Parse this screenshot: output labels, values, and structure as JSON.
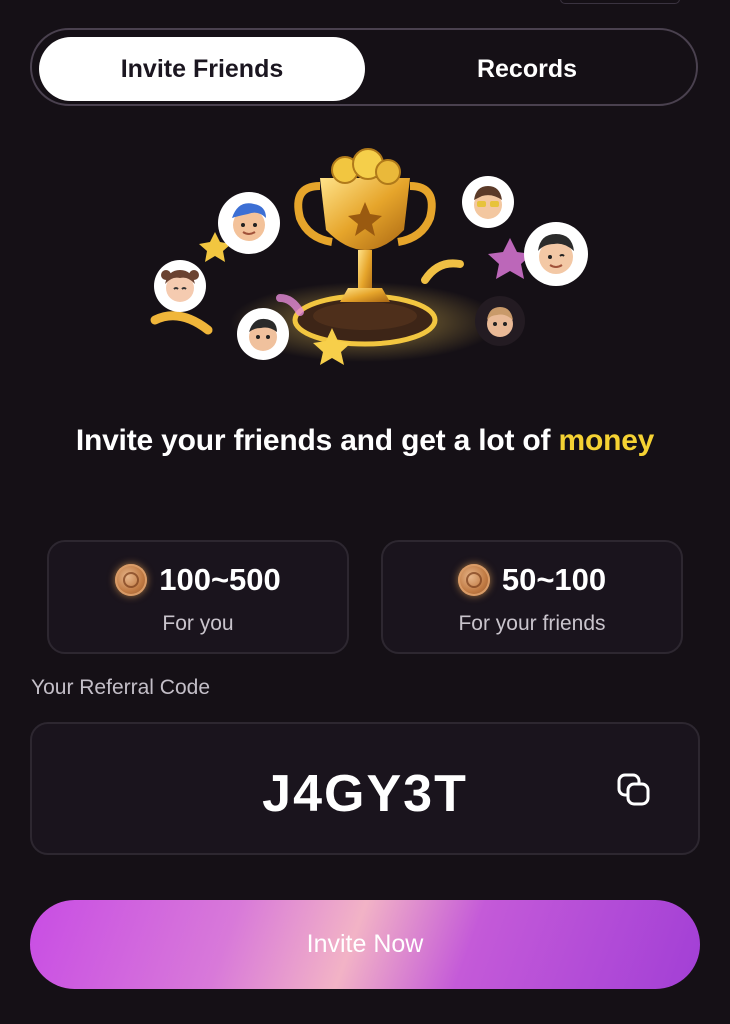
{
  "tabs": [
    {
      "label": "Invite Friends",
      "active": true
    },
    {
      "label": "Records",
      "active": false
    }
  ],
  "headline": {
    "text": "Invite your friends and get a lot of ",
    "highlight": "money",
    "highlight_color": "#f5d233"
  },
  "rewards": [
    {
      "amount": "100~500",
      "subtitle": "For you",
      "icon": "coin-icon"
    },
    {
      "amount": "50~100",
      "subtitle": "For your friends",
      "icon": "coin-icon"
    }
  ],
  "referral": {
    "label": "Your Referral Code",
    "code": "J4GY3T",
    "copy_icon": "copy-icon"
  },
  "cta": {
    "label": "Invite Now"
  },
  "colors": {
    "background": "#151016",
    "accent_yellow": "#f5d233",
    "button_purple": "#b84ee0"
  }
}
